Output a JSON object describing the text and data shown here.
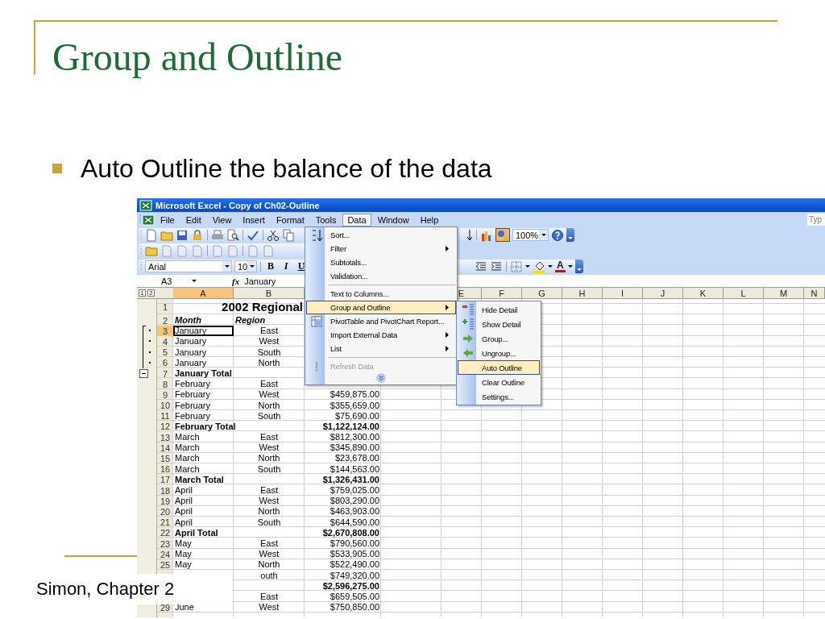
{
  "slide": {
    "title": "Group and Outline",
    "bullets": [
      "Auto Outline the balance of the data"
    ],
    "footer": "Simon, Chapter 2"
  },
  "window": {
    "title": "Microsoft Excel - Copy of Ch02-Outline",
    "help_box": "Typ",
    "menu": [
      {
        "label": "File",
        "selected": false
      },
      {
        "label": "Edit",
        "selected": false
      },
      {
        "label": "View",
        "selected": false
      },
      {
        "label": "Insert",
        "selected": false
      },
      {
        "label": "Format",
        "selected": false
      },
      {
        "label": "Tools",
        "selected": false
      },
      {
        "label": "Data",
        "selected": true
      },
      {
        "label": "Window",
        "selected": false
      },
      {
        "label": "Help",
        "selected": false
      }
    ]
  },
  "standard_toolbar": {
    "zoom": "100%"
  },
  "format_toolbar": {
    "font": "Arial",
    "size": "10",
    "buttons": [
      "B",
      "I",
      "U"
    ],
    "font_color": "A"
  },
  "formula_bar": {
    "name_box": "A3",
    "function_label": "fx",
    "formula": "January"
  },
  "outline_levels": [
    "1",
    "2"
  ],
  "columns": [
    {
      "label": "A",
      "selected": true
    },
    {
      "label": "B",
      "selected": false
    },
    {
      "label": "E",
      "selected": false
    },
    {
      "label": "F",
      "selected": false
    },
    {
      "label": "G",
      "selected": false
    },
    {
      "label": "H",
      "selected": false
    },
    {
      "label": "I",
      "selected": false
    },
    {
      "label": "J",
      "selected": false
    },
    {
      "label": "K",
      "selected": false
    },
    {
      "label": "L",
      "selected": false
    },
    {
      "label": "M",
      "selected": false
    },
    {
      "label": "N",
      "selected": false
    }
  ],
  "rows": [
    {
      "number": "1",
      "kind": "title",
      "a": "2002 Regional",
      "selected": false,
      "grouped": false,
      "collapsible": false
    },
    {
      "number": "2",
      "kind": "header",
      "a": "Month",
      "b": "Region",
      "selected": false,
      "grouped": false,
      "collapsible": false
    },
    {
      "number": "3",
      "kind": "detail",
      "a": "January",
      "b": "East",
      "selected": true,
      "grouped": true,
      "collapsible": false
    },
    {
      "number": "4",
      "kind": "detail",
      "a": "January",
      "b": "West",
      "selected": false,
      "grouped": true,
      "collapsible": false
    },
    {
      "number": "5",
      "kind": "detail",
      "a": "January",
      "b": "South",
      "selected": false,
      "grouped": true,
      "collapsible": false
    },
    {
      "number": "6",
      "kind": "detail",
      "a": "January",
      "b": "North",
      "selected": false,
      "grouped": true,
      "collapsible": false
    },
    {
      "number": "7",
      "kind": "total",
      "a": "January Total",
      "selected": false,
      "grouped": false,
      "collapsible": true
    },
    {
      "number": "8",
      "kind": "detail",
      "a": "February",
      "b": "East",
      "selected": false,
      "grouped": false,
      "collapsible": false
    },
    {
      "number": "9",
      "kind": "detail",
      "a": "February",
      "b": "West",
      "c": "$459,875.00",
      "selected": false,
      "grouped": false,
      "collapsible": false
    },
    {
      "number": "10",
      "kind": "detail",
      "a": "February",
      "b": "North",
      "c": "$355,659.00",
      "selected": false,
      "grouped": false,
      "collapsible": false
    },
    {
      "number": "11",
      "kind": "detail",
      "a": "February",
      "b": "South",
      "c": "$75,690.00",
      "selected": false,
      "grouped": false,
      "collapsible": false
    },
    {
      "number": "12",
      "kind": "total",
      "a": "February Total",
      "c": "$1,122,124.00",
      "selected": false,
      "grouped": false,
      "collapsible": false
    },
    {
      "number": "13",
      "kind": "detail",
      "a": "March",
      "b": "East",
      "c": "$812,300.00",
      "selected": false,
      "grouped": false,
      "collapsible": false
    },
    {
      "number": "14",
      "kind": "detail",
      "a": "March",
      "b": "West",
      "c": "$345,890.00",
      "selected": false,
      "grouped": false,
      "collapsible": false
    },
    {
      "number": "15",
      "kind": "detail",
      "a": "March",
      "b": "North",
      "c": "$23,678.00",
      "selected": false,
      "grouped": false,
      "collapsible": false
    },
    {
      "number": "16",
      "kind": "detail",
      "a": "March",
      "b": "South",
      "c": "$144,563.00",
      "selected": false,
      "grouped": false,
      "collapsible": false
    },
    {
      "number": "17",
      "kind": "total",
      "a": "March Total",
      "c": "$1,326,431.00",
      "selected": false,
      "grouped": false,
      "collapsible": false
    },
    {
      "number": "18",
      "kind": "detail",
      "a": "April",
      "b": "East",
      "c": "$759,025.00",
      "selected": false,
      "grouped": false,
      "collapsible": false
    },
    {
      "number": "19",
      "kind": "detail",
      "a": "April",
      "b": "West",
      "c": "$803,290.00",
      "selected": false,
      "grouped": false,
      "collapsible": false
    },
    {
      "number": "20",
      "kind": "detail",
      "a": "April",
      "b": "North",
      "c": "$463,903.00",
      "selected": false,
      "grouped": false,
      "collapsible": false
    },
    {
      "number": "21",
      "kind": "detail",
      "a": "April",
      "b": "South",
      "c": "$644,590.00",
      "selected": false,
      "grouped": false,
      "collapsible": false
    },
    {
      "number": "22",
      "kind": "total",
      "a": "April Total",
      "c": "$2,670,808.00",
      "selected": false,
      "grouped": false,
      "collapsible": false
    },
    {
      "number": "23",
      "kind": "detail",
      "a": "May",
      "b": "East",
      "c": "$790,560.00",
      "selected": false,
      "grouped": false,
      "collapsible": false
    },
    {
      "number": "24",
      "kind": "detail",
      "a": "May",
      "b": "West",
      "c": "$533,905.00",
      "selected": false,
      "grouped": false,
      "collapsible": false
    },
    {
      "number": "25",
      "kind": "detail",
      "a": "May",
      "b": "North",
      "c": "$522,490.00",
      "selected": false,
      "grouped": false,
      "collapsible": false
    },
    {
      "kind": "detail",
      "b": "outh",
      "c": "$749,320.00"
    },
    {
      "kind": "total",
      "c": "$2,596,275.00"
    },
    {
      "kind": "detail",
      "b": "East",
      "c": "$659,505.00"
    },
    {
      "number": "29",
      "kind": "detail",
      "a": "June",
      "b": "West",
      "c": "$750,850.00",
      "selected": false,
      "grouped": false,
      "collapsible": false
    }
  ],
  "data_menu": {
    "items": [
      {
        "kind": "item",
        "label": "Sort...",
        "submenu": false,
        "selected": false,
        "disabled": false
      },
      {
        "kind": "item",
        "label": "Filter",
        "submenu": true,
        "selected": false,
        "disabled": false
      },
      {
        "kind": "item",
        "label": "Subtotals...",
        "submenu": false,
        "selected": false,
        "disabled": false
      },
      {
        "kind": "item",
        "label": "Validation...",
        "submenu": false,
        "selected": false,
        "disabled": false
      },
      {
        "kind": "separator"
      },
      {
        "kind": "item",
        "label": "Text to Columns...",
        "submenu": false,
        "selected": false,
        "disabled": false
      },
      {
        "kind": "item",
        "label": "Group and Outline",
        "submenu": true,
        "selected": true,
        "disabled": false
      },
      {
        "kind": "item",
        "label": "PivotTable and PivotChart Report...",
        "submenu": false,
        "selected": false,
        "disabled": false
      },
      {
        "kind": "item",
        "label": "Import External Data",
        "submenu": true,
        "selected": false,
        "disabled": false
      },
      {
        "kind": "item",
        "label": "List",
        "submenu": true,
        "selected": false,
        "disabled": false
      },
      {
        "kind": "separator"
      },
      {
        "kind": "item",
        "label": "Refresh Data",
        "submenu": false,
        "selected": false,
        "disabled": true
      }
    ]
  },
  "outline_menu": {
    "items": [
      {
        "kind": "item",
        "label": "Hide Detail",
        "submenu": false,
        "selected": false,
        "disabled": false
      },
      {
        "kind": "item",
        "label": "Show Detail",
        "submenu": false,
        "selected": false,
        "disabled": false
      },
      {
        "kind": "item",
        "label": "Group...",
        "submenu": false,
        "selected": false,
        "disabled": false
      },
      {
        "kind": "item",
        "label": "Ungroup...",
        "submenu": false,
        "selected": false,
        "disabled": false
      },
      {
        "kind": "item",
        "label": "Auto Outline",
        "submenu": false,
        "selected": true,
        "disabled": false
      },
      {
        "kind": "item",
        "label": "Clear Outline",
        "submenu": false,
        "selected": false,
        "disabled": false
      },
      {
        "kind": "item",
        "label": "Settings...",
        "submenu": false,
        "selected": false,
        "disabled": false
      }
    ]
  }
}
